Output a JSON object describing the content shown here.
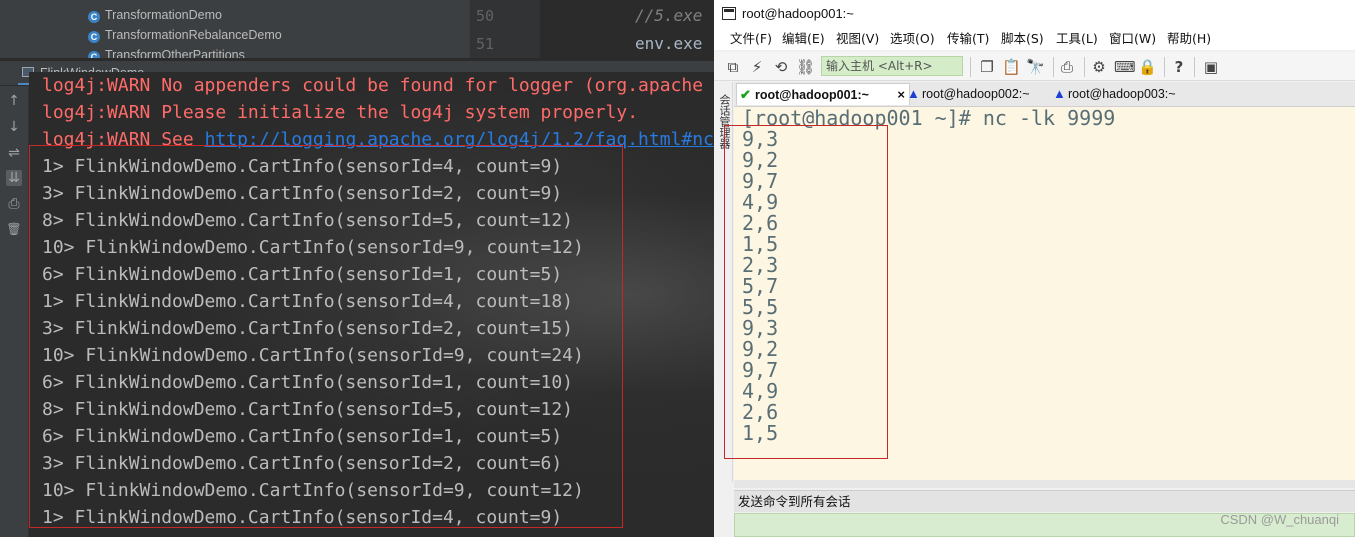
{
  "ide": {
    "tree_items": [
      "TransformationDemo",
      "TransformationRebalanceDemo",
      "TransformOtherPartitions"
    ],
    "class_icon_letter": "C",
    "editor": {
      "line_numbers": [
        "50",
        "51"
      ],
      "code_lines": [
        "//5.exe",
        "env.exe"
      ]
    },
    "run_tab_label": "FlinkWindowDemo",
    "console_lines": [
      {
        "text": "log4j:WARN No appenders could be found for logger (org.apache",
        "kind": "warn"
      },
      {
        "text": "log4j:WARN Please initialize the log4j system properly.",
        "kind": "warn"
      },
      {
        "text": "log4j:WARN See ",
        "kind": "warn",
        "link": "http://logging.apache.org/log4j/1.2/faq.html#nc"
      },
      {
        "text": "1> FlinkWindowDemo.CartInfo(sensorId=4, count=9)",
        "kind": "out"
      },
      {
        "text": "3> FlinkWindowDemo.CartInfo(sensorId=2, count=9)",
        "kind": "out"
      },
      {
        "text": "8> FlinkWindowDemo.CartInfo(sensorId=5, count=12)",
        "kind": "out"
      },
      {
        "text": "10> FlinkWindowDemo.CartInfo(sensorId=9, count=12)",
        "kind": "out"
      },
      {
        "text": "6> FlinkWindowDemo.CartInfo(sensorId=1, count=5)",
        "kind": "out"
      },
      {
        "text": "1> FlinkWindowDemo.CartInfo(sensorId=4, count=18)",
        "kind": "out"
      },
      {
        "text": "3> FlinkWindowDemo.CartInfo(sensorId=2, count=15)",
        "kind": "out"
      },
      {
        "text": "10> FlinkWindowDemo.CartInfo(sensorId=9, count=24)",
        "kind": "out"
      },
      {
        "text": "6> FlinkWindowDemo.CartInfo(sensorId=1, count=10)",
        "kind": "out"
      },
      {
        "text": "8> FlinkWindowDemo.CartInfo(sensorId=5, count=12)",
        "kind": "out"
      },
      {
        "text": "6> FlinkWindowDemo.CartInfo(sensorId=1, count=5)",
        "kind": "out"
      },
      {
        "text": "3> FlinkWindowDemo.CartInfo(sensorId=2, count=6)",
        "kind": "out"
      },
      {
        "text": "10> FlinkWindowDemo.CartInfo(sensorId=9, count=12)",
        "kind": "out"
      },
      {
        "text": "1> FlinkWindowDemo.CartInfo(sensorId=4, count=9)",
        "kind": "out"
      }
    ],
    "tools": [
      {
        "name": "scroll-up-icon",
        "glyph": "↑"
      },
      {
        "name": "scroll-down-icon",
        "glyph": "↓"
      },
      {
        "name": "soft-wrap-icon",
        "glyph": "⇌"
      },
      {
        "name": "scroll-to-end-icon",
        "glyph": "⇊"
      },
      {
        "name": "print-icon",
        "glyph": "⎙"
      },
      {
        "name": "trash-icon",
        "glyph": "🗑"
      }
    ]
  },
  "xshell": {
    "title": "root@hadoop001:~",
    "menu": [
      "文件(F)",
      "编辑(E)",
      "视图(V)",
      "选项(O)",
      "传输(T)",
      "脚本(S)",
      "工具(L)",
      "窗口(W)",
      "帮助(H)"
    ],
    "host_placeholder": "输入主机 <Alt+R>",
    "sidebar_label": "会话管理器",
    "tabs": [
      {
        "label": "root@hadoop001:~",
        "status": "connected",
        "active": true,
        "close": "×"
      },
      {
        "label": "root@hadoop002:~",
        "status": "warning",
        "active": false
      },
      {
        "label": "root@hadoop003:~",
        "status": "warning",
        "active": false
      }
    ],
    "terminal_prompt": "[root@hadoop001 ~]# nc -lk 9999",
    "terminal_lines": [
      "9,3",
      "9,2",
      "9,7",
      "4,9",
      "2,6",
      "1,5",
      "2,3",
      "5,7",
      "5,5",
      "9,3",
      "9,2",
      "9,7",
      "4,9",
      "2,6",
      "1,5"
    ],
    "send_bar_label": "发送命令到所有会话",
    "watermark": "CSDN @W_chuanqi"
  },
  "colors": {
    "console_warn": "#ff6b68",
    "console_link": "#287bde",
    "console_text": "#bbbbbb",
    "terminal_bg": "#fdf6e3",
    "terminal_text": "#586e75",
    "highlight_box": "#c62828",
    "host_input_bg": "#d4ecc8"
  }
}
